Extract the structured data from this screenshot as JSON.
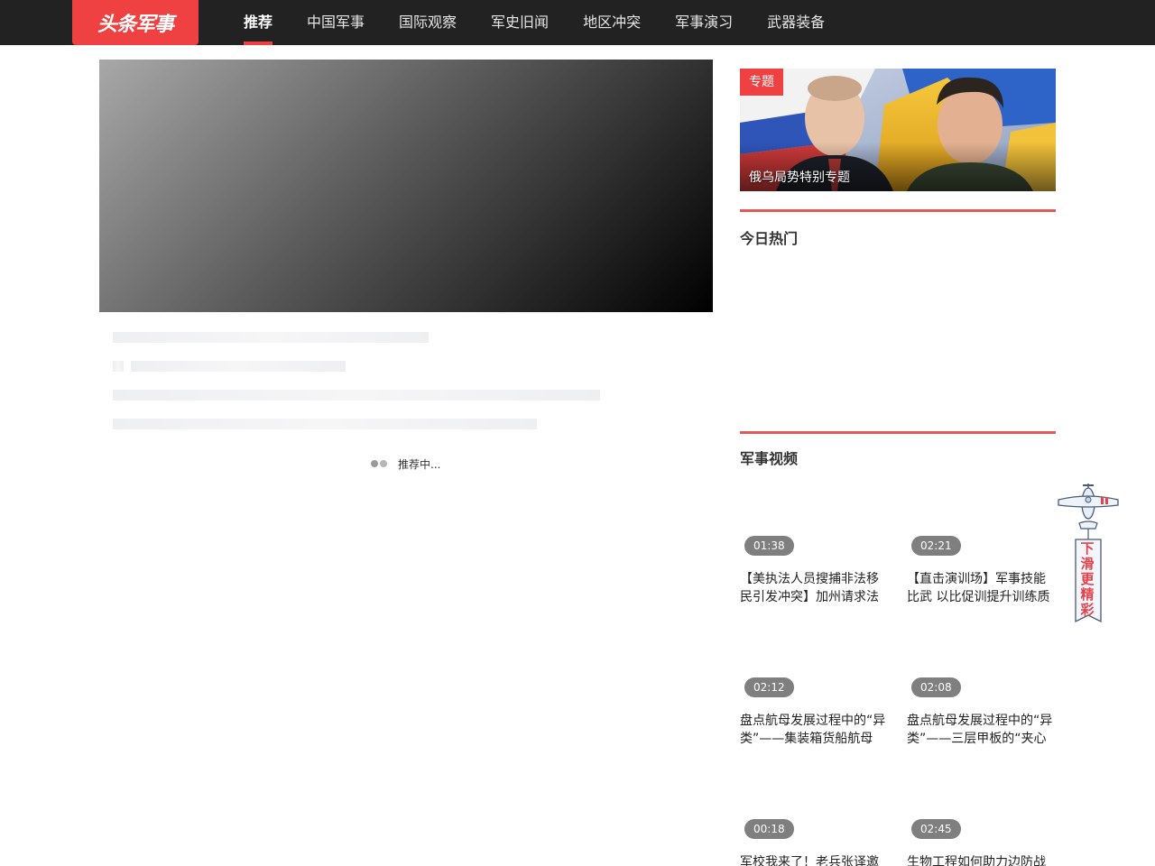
{
  "header": {
    "logo": "头条军事",
    "nav": [
      "推荐",
      "中国军事",
      "国际观察",
      "军史旧闻",
      "地区冲突",
      "军事演习",
      "武器装备"
    ],
    "active_index": 0
  },
  "feed": {
    "loading_text": "推荐中..."
  },
  "sidebar": {
    "special": {
      "tag": "专题",
      "title": "俄乌局势特别专题"
    },
    "hot_title": "今日热门",
    "video_section_title": "军事视频",
    "videos": [
      {
        "duration": "01:38",
        "title": "【美执法人员搜捕非法移民引发冲突】加州请求法"
      },
      {
        "duration": "02:21",
        "title": "【直击演训场】军事技能比武 以比促训提升训练质"
      },
      {
        "duration": "02:12",
        "title": "盘点航母发展过程中的“异类”——集装箱货船航母"
      },
      {
        "duration": "02:08",
        "title": "盘点航母发展过程中的“异类”——三层甲板的“夹心饼"
      },
      {
        "duration": "00:18",
        "title": "军校我来了！老兵张译邀"
      },
      {
        "duration": "02:45",
        "title": "生物工程如何助力边防战"
      }
    ]
  },
  "mascot": {
    "banner_text": "下滑更精彩"
  },
  "colors": {
    "brand": "#f04142",
    "nav_bg": "#222222",
    "section_line": "#e05a5a"
  }
}
